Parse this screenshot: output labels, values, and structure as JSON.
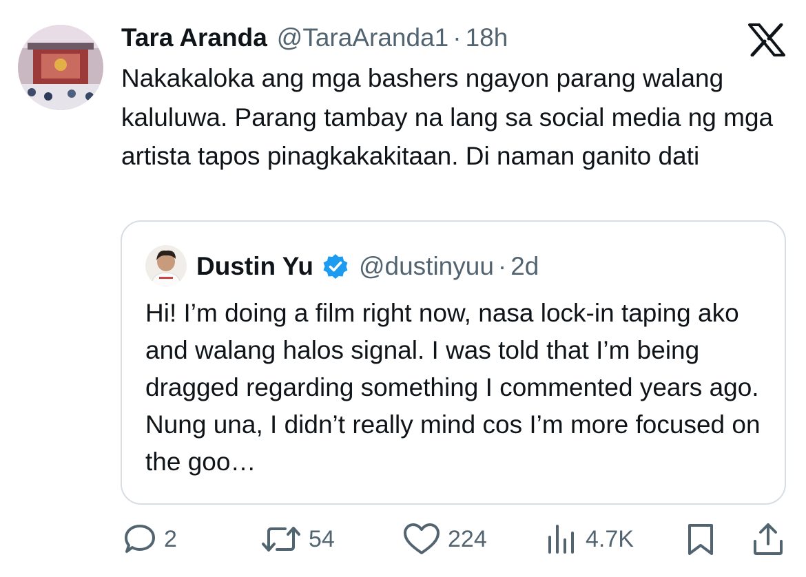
{
  "tweet": {
    "author_name": "Tara Aranda",
    "handle": "@TaraAranda1",
    "separator": "·",
    "time": "18h",
    "text": "Nakakaloka ang mga bashers ngayon parang walang kaluluwa. Parang tambay na lang sa social media ng mga artista tapos pinagkakakitaan. Di naman ganito dati"
  },
  "quote": {
    "author_name": "Dustin Yu",
    "verified": true,
    "handle": "@dustinyuu",
    "separator": "·",
    "time": "2d",
    "text": "Hi! I’m doing a film right now, nasa lock-in taping ako and walang halos signal. I was told that I’m being dragged regarding something I commented years ago. Nung una, I didn’t really mind cos I’m more focused on the goo…"
  },
  "actions": {
    "replies": "2",
    "reposts": "54",
    "likes": "224",
    "views": "4.7K"
  },
  "icons": {
    "brand": "x-logo-icon",
    "reply": "reply-bubble-icon",
    "repost": "repost-arrows-icon",
    "like": "heart-icon",
    "views": "bar-chart-icon",
    "bookmark": "bookmark-icon",
    "share": "share-upload-icon",
    "verified": "verified-badge-icon"
  },
  "colors": {
    "text_primary": "#0f1419",
    "text_secondary": "#536471",
    "verified_blue": "#1d9bf0",
    "border": "#d7dde2"
  }
}
